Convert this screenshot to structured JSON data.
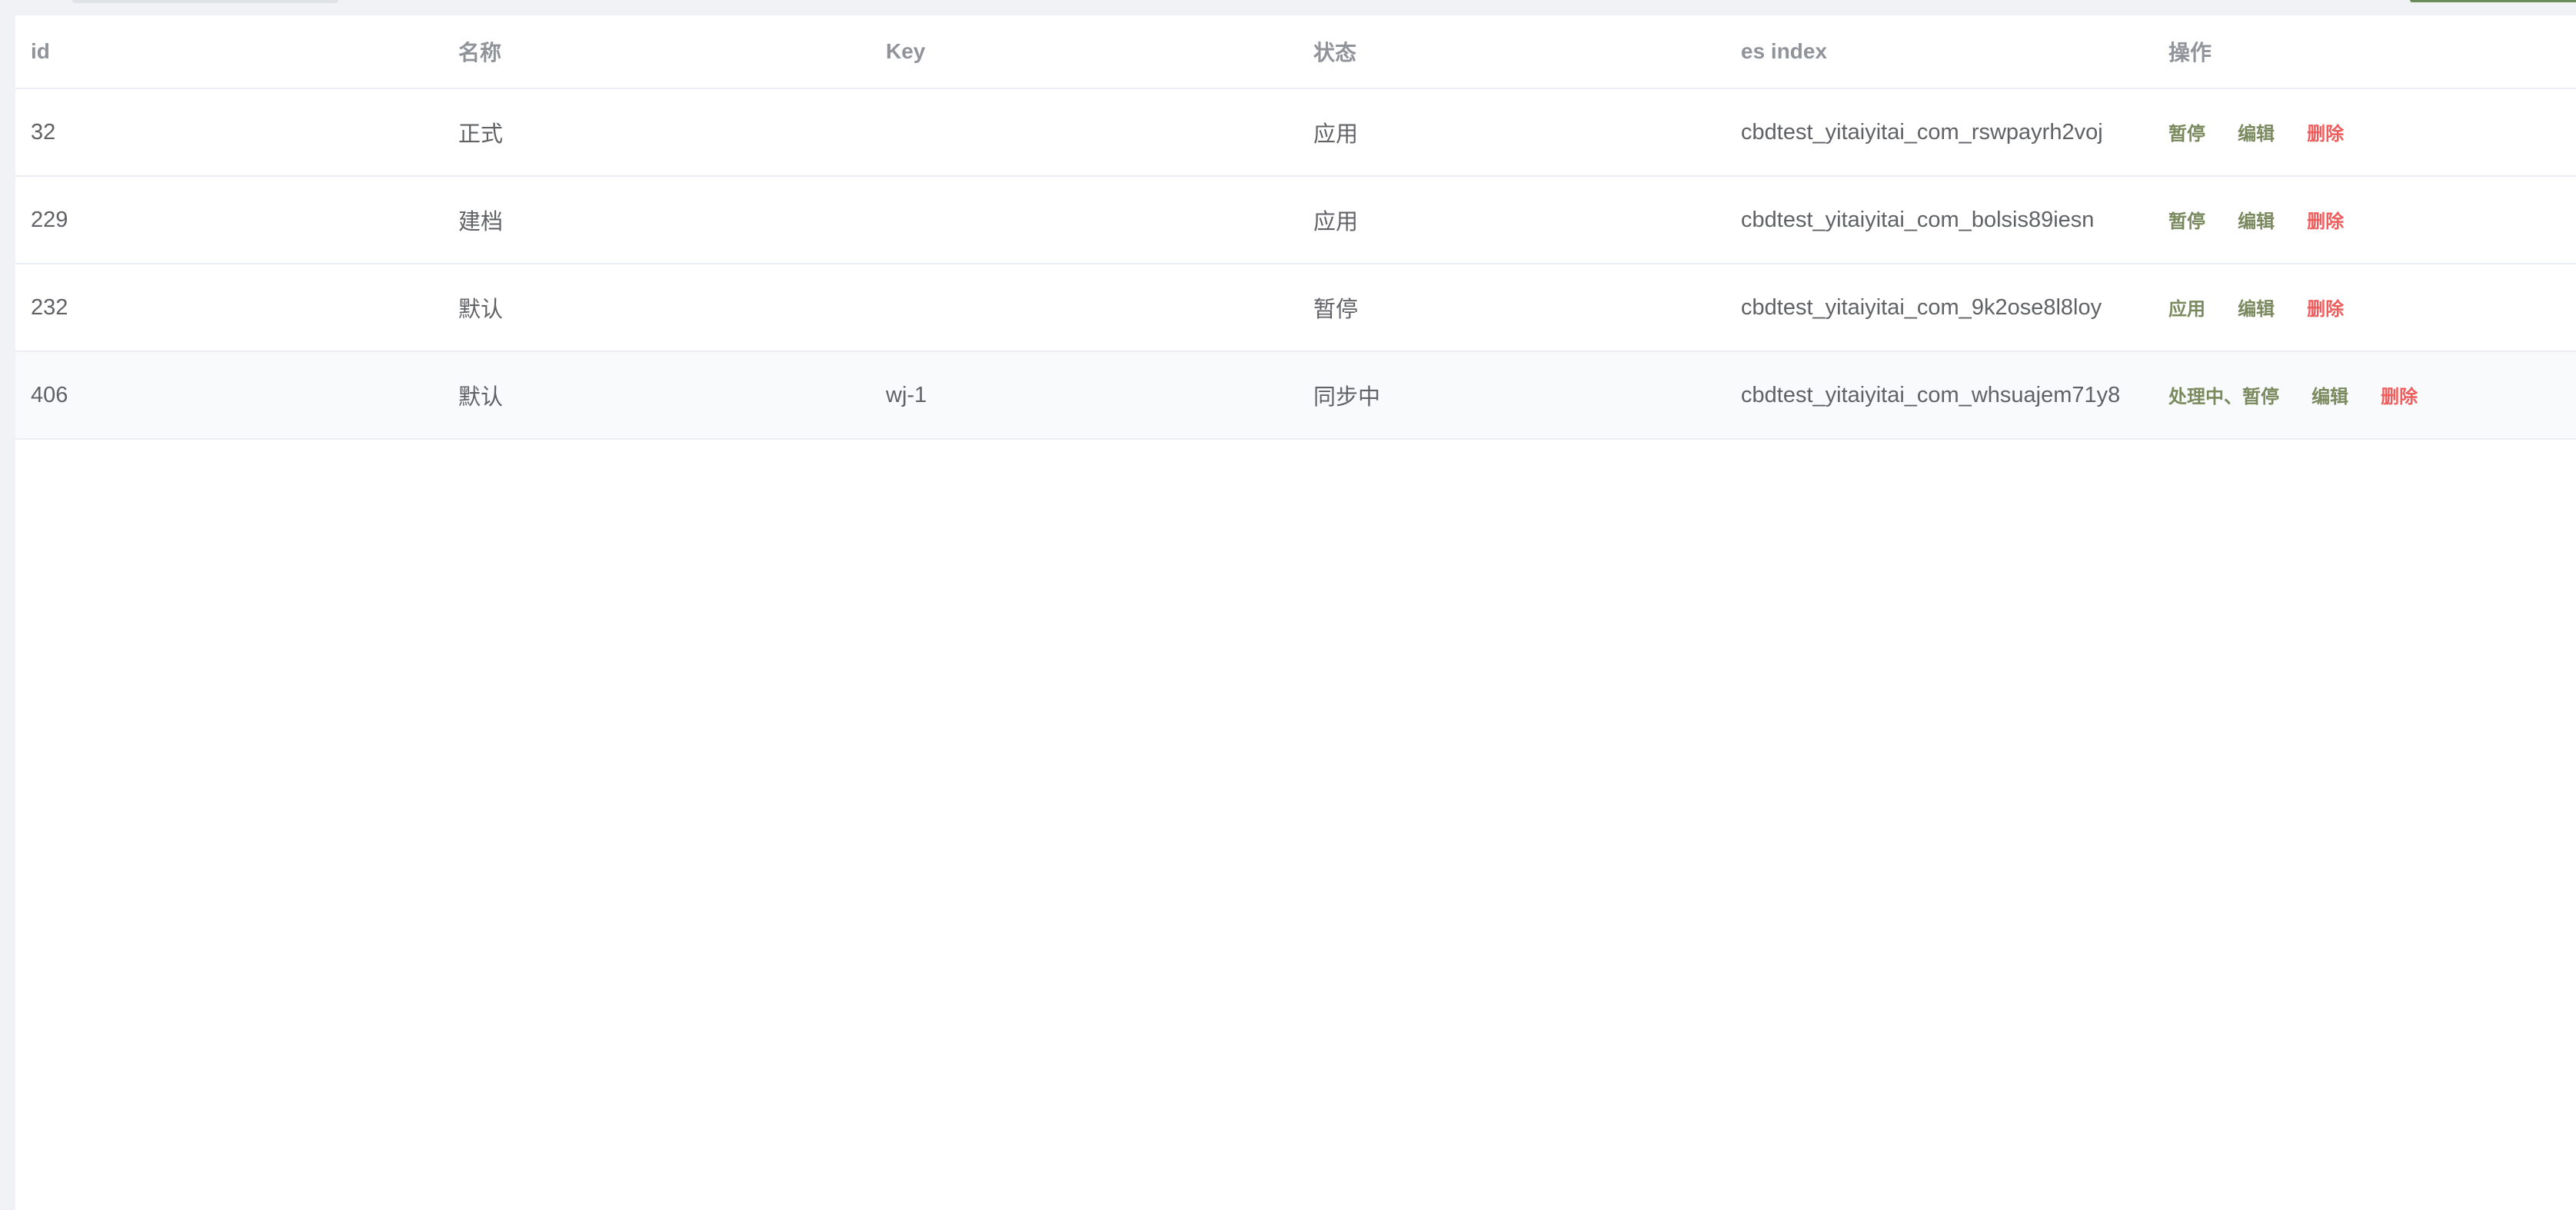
{
  "table": {
    "columns": [
      "id",
      "名称",
      "Key",
      "状态",
      "es index",
      "操作"
    ],
    "rows": [
      {
        "id": "32",
        "name": "正式",
        "key": "",
        "status": "应用",
        "es_index": "cbdtest_yitaiyitai_com_rswpayrh2voj",
        "actions": [
          "暂停",
          "编辑",
          "删除"
        ]
      },
      {
        "id": "229",
        "name": "建档",
        "key": "",
        "status": "应用",
        "es_index": "cbdtest_yitaiyitai_com_bolsis89iesn",
        "actions": [
          "暂停",
          "编辑",
          "删除"
        ]
      },
      {
        "id": "232",
        "name": "默认",
        "key": "",
        "status": "暂停",
        "es_index": "cbdtest_yitaiyitai_com_9k2ose8l8loy",
        "actions": [
          "应用",
          "编辑",
          "删除"
        ]
      },
      {
        "id": "406",
        "name": "默认",
        "key": "wj-1",
        "status": "同步中",
        "es_index": "cbdtest_yitaiyitai_com_whsuajem71y8",
        "actions": [
          "处理中、暂停",
          "编辑",
          "删除"
        ]
      }
    ]
  },
  "colors": {
    "action": "#7a8a5e",
    "delete": "#f05d5d",
    "header_text": "#909399",
    "cell_text": "#606266",
    "row_border": "#ebeef5"
  }
}
